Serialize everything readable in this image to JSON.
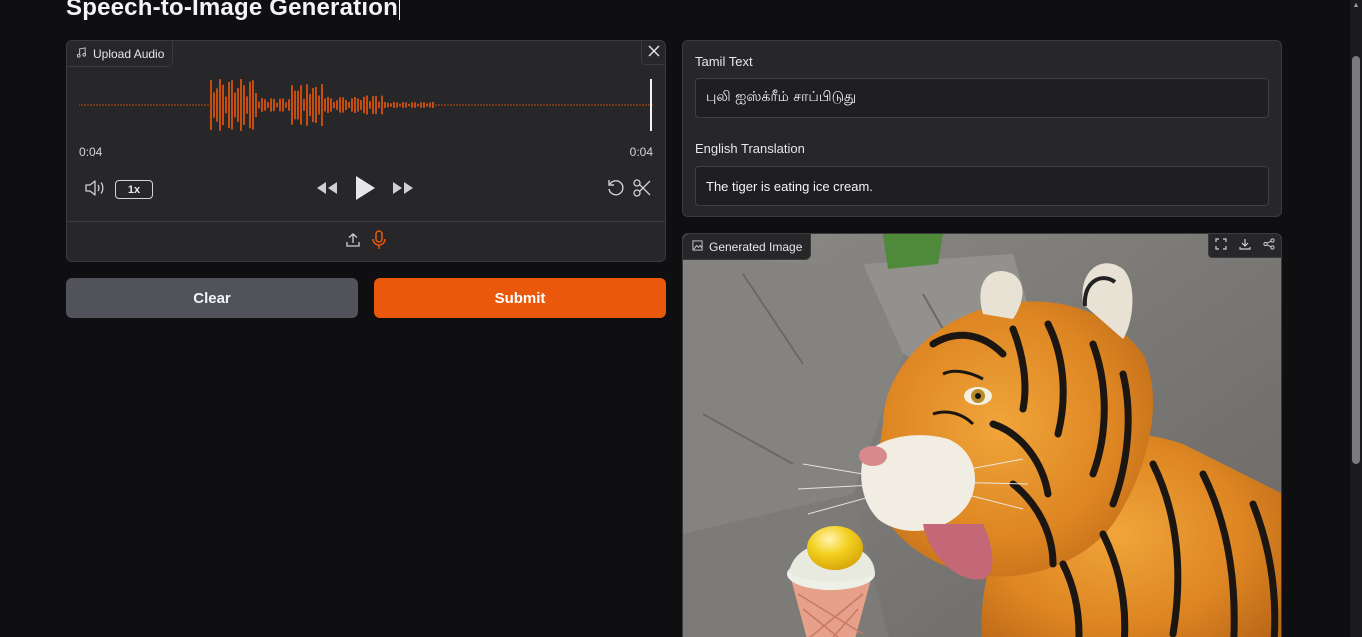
{
  "page": {
    "title": "Speech-to-Image Generation"
  },
  "audio": {
    "label": "Upload Audio",
    "current_time": "0:04",
    "duration": "0:04",
    "playback_speed": "1x",
    "icons": [
      "music-note-icon",
      "close-icon",
      "volume-icon",
      "rewind-icon",
      "play-icon",
      "fast-forward-icon",
      "reset-icon",
      "trim-icon",
      "upload-icon",
      "microphone-icon"
    ]
  },
  "actions": {
    "clear_label": "Clear",
    "submit_label": "Submit"
  },
  "tamil": {
    "label": "Tamil Text",
    "value": "புலி ஐஸ்க்ரீம் சாப்பிடுது"
  },
  "english": {
    "label": "English Translation",
    "value": "The tiger is eating ice cream."
  },
  "output": {
    "label": "Generated Image",
    "tools": [
      "fullscreen-icon",
      "download-icon",
      "share-icon"
    ]
  },
  "colors": {
    "accent": "#ea580c",
    "panel": "#27272a",
    "background": "#0f0f11",
    "button_secondary": "#52525b"
  }
}
